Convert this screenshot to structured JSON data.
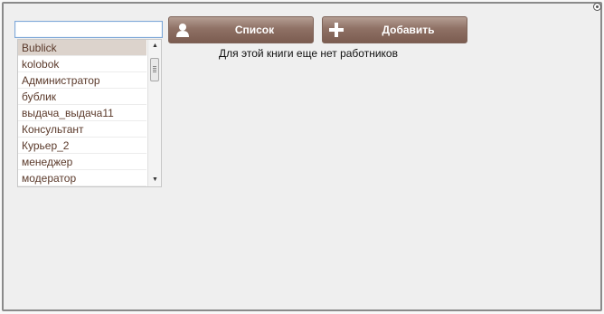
{
  "search": {
    "value": "",
    "placeholder": ""
  },
  "list": {
    "items": [
      {
        "label": "Bublick",
        "selected": true
      },
      {
        "label": "kolobok",
        "selected": false
      },
      {
        "label": "Администратор",
        "selected": false
      },
      {
        "label": "бублик",
        "selected": false
      },
      {
        "label": "выдача_выдача11",
        "selected": false
      },
      {
        "label": "Консультант",
        "selected": false
      },
      {
        "label": "Курьер_2",
        "selected": false
      },
      {
        "label": "менеджер",
        "selected": false
      },
      {
        "label": "модератор",
        "selected": false
      }
    ]
  },
  "toolbar": {
    "list_label": "Список",
    "list_icon": "user-icon",
    "add_label": "Добавить",
    "add_icon": "plus-icon"
  },
  "message": "Для этой книги еще нет работников",
  "colors": {
    "button": "#8f7165",
    "item_text": "#5b3a2b",
    "selected_bg": "#dcd3cc"
  }
}
